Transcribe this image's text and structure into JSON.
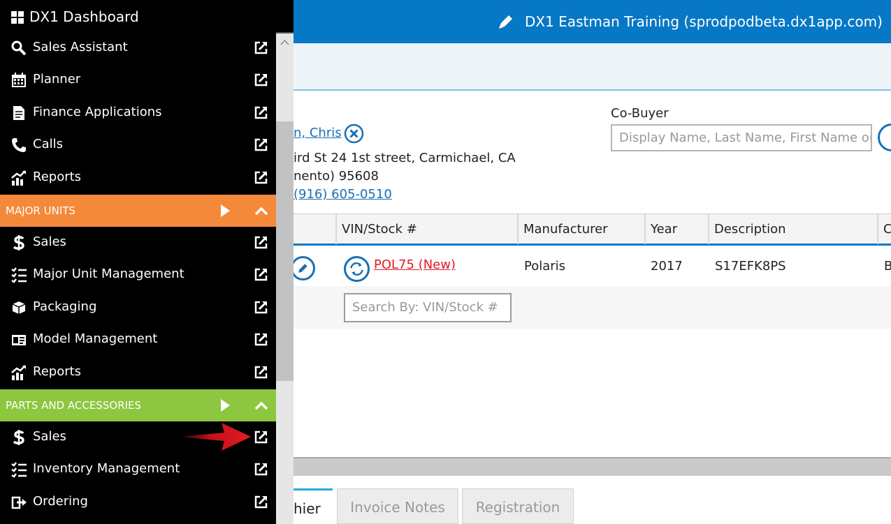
{
  "header": {
    "title": "DX1 Eastman Training (sprodpodbeta.dx1app.com)",
    "edit_icon": "pencil-icon",
    "bg_color": "#0778c6"
  },
  "sidebar": {
    "app_title": "DX1 Dashboard",
    "app_icon": "windows-grid-icon",
    "top_items": [
      {
        "label": "Sales Assistant",
        "icon": "search-icon"
      },
      {
        "label": "Planner",
        "icon": "calendar-icon"
      },
      {
        "label": "Finance Applications",
        "icon": "document-icon"
      },
      {
        "label": "Calls",
        "icon": "phone-icon"
      },
      {
        "label": "Reports",
        "icon": "chart-icon"
      }
    ],
    "major_units": {
      "title": "MAJOR UNITS",
      "color": "#f5893a",
      "items": [
        {
          "label": "Sales",
          "icon": "dollar-icon"
        },
        {
          "label": "Major Unit Management",
          "icon": "list-icon"
        },
        {
          "label": "Packaging",
          "icon": "box-icon"
        },
        {
          "label": "Model Management",
          "icon": "card-icon"
        },
        {
          "label": "Reports",
          "icon": "chart-icon"
        }
      ]
    },
    "parts_accessories": {
      "title": "PARTS AND ACCESSORIES",
      "color": "#8dc63f",
      "items": [
        {
          "label": "Sales",
          "icon": "dollar-icon"
        },
        {
          "label": "Inventory Management",
          "icon": "list-icon"
        },
        {
          "label": "Ordering",
          "icon": "order-icon"
        }
      ]
    },
    "annotation_arrow_color": "#e11b22"
  },
  "customer": {
    "name_fragment": "n, Chris",
    "address_line1": "ird St 24 1st street, Carmichael, CA",
    "address_line2": "nento) 95608",
    "phone": "(916) 605-0510"
  },
  "cobuyer": {
    "label": "Co-Buyer",
    "placeholder": "Display Name, Last Name, First Name or"
  },
  "units_table": {
    "columns": [
      "VIN/Stock #",
      "Manufacturer",
      "Year",
      "Description",
      "C"
    ],
    "rows": [
      {
        "stock": "POL75 (New)",
        "manufacturer": "Polaris",
        "year": "2017",
        "description": "S17EFK8PS",
        "extra": "B"
      }
    ],
    "search_placeholder": "Search By: VIN/Stock #"
  },
  "tabs": [
    {
      "label": "hier",
      "active": true
    },
    {
      "label": "Invoice Notes",
      "active": false
    },
    {
      "label": "Registration",
      "active": false
    }
  ]
}
